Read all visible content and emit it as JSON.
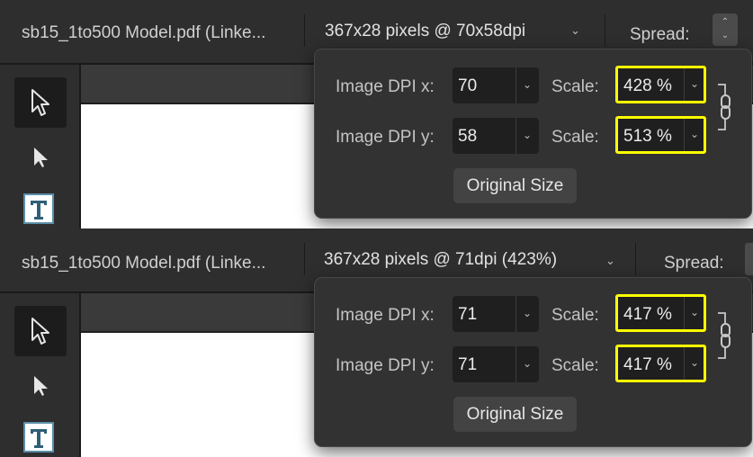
{
  "panels": [
    {
      "document": "sb15_1to500 Model.pdf (Linke...",
      "pixel_info": "367x28 pixels @ 70x58dpi",
      "spread_label": "Spread:",
      "popover": {
        "dpi_x_label": "Image DPI x:",
        "dpi_x_value": "70",
        "dpi_y_label": "Image DPI y:",
        "dpi_y_value": "58",
        "scale_label": "Scale:",
        "scale_x_value": "428 %",
        "scale_y_value": "513 %",
        "original_size_label": "Original Size"
      }
    },
    {
      "document": "sb15_1to500 Model.pdf (Linke...",
      "pixel_info": "367x28 pixels @ 71dpi (423%)",
      "spread_label": "Spread:",
      "popover": {
        "dpi_x_label": "Image DPI x:",
        "dpi_x_value": "71",
        "dpi_y_label": "Image DPI y:",
        "dpi_y_value": "71",
        "scale_label": "Scale:",
        "scale_x_value": "417 %",
        "scale_y_value": "417 %",
        "original_size_label": "Original Size"
      }
    }
  ],
  "icons": {
    "chevron": "chevron-down-icon",
    "stepper": "up-down-stepper-icon",
    "move_tool": "move-tool-arrow-icon",
    "node_tool": "node-tool-arrow-icon",
    "text_tool": "text-frame-tool-icon",
    "link": "chain-link-icon"
  },
  "colors": {
    "highlight": "#ffff00",
    "panel_bg": "#2b2b2b",
    "popover_bg": "#323232",
    "field_bg": "#1f1f1f",
    "text_tool_accent": "#5b8fa8"
  }
}
